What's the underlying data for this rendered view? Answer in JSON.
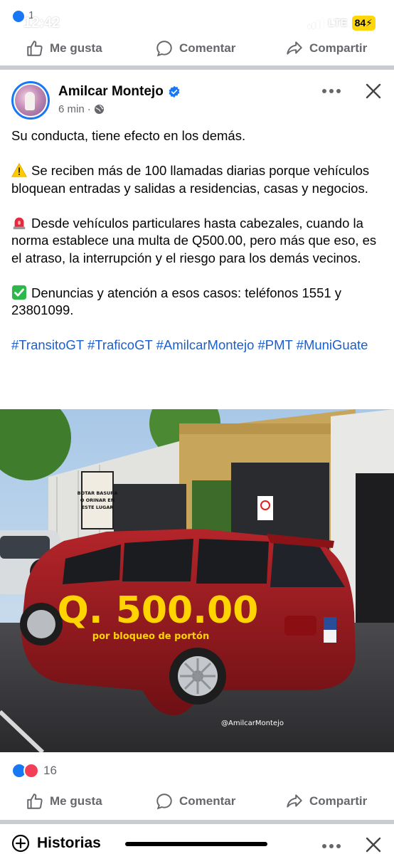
{
  "status_bar": {
    "time": "12:42",
    "network": "LTE",
    "battery": "84",
    "notification_count": "1"
  },
  "prev_post_actions": {
    "like_label": "Me gusta",
    "comment_label": "Comentar",
    "share_label": "Compartir"
  },
  "post": {
    "author": "Amilcar Montejo",
    "time": "6 min",
    "paragraphs": [
      "Su conducta, tiene efecto en los demás.",
      "Se reciben más de 100 llamadas diarias porque vehículos bloquean entradas y salidas a residencias, casas y negocios.",
      "Desde vehículos particulares hasta cabezales, cuando la norma establece una multa de Q500.00, pero más que eso, es el atraso, la interrupción y el riesgo para los demás vecinos.",
      "Denuncias y atención a esos casos: teléfonos 1551 y 23801099."
    ],
    "hashtags": [
      "#TransitoGT",
      "#TraficoGT",
      "#AmilcarMontejo",
      "#PMT",
      "#MuniGuate"
    ],
    "image": {
      "amount": "Q. 500.00",
      "caption": "por bloqueo de portón",
      "credit": "@AmilcarMontejo",
      "sign_text": "BOTAR BASURA O ORINAR EN ESTE LUGAR"
    },
    "reaction_count": "16",
    "actions": {
      "like_label": "Me gusta",
      "comment_label": "Comentar",
      "share_label": "Compartir"
    }
  },
  "stories": {
    "title": "Historias"
  },
  "colors": {
    "accent": "#1877f2",
    "link": "#1b5fcc",
    "muted": "#65676b",
    "image_highlight": "#ffd400"
  },
  "icons": [
    "like-icon",
    "comment-icon",
    "share-icon",
    "verified-icon",
    "globe-icon",
    "more-icon",
    "close-icon",
    "warning-icon",
    "siren-icon",
    "check-icon",
    "plus-circle-icon"
  ]
}
